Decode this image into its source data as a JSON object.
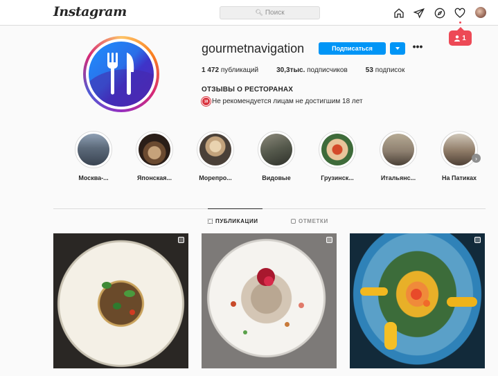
{
  "header": {
    "logo": "Instagram",
    "search_placeholder": "Поиск",
    "notification_count": "1"
  },
  "profile": {
    "username": "gourmetnavigation",
    "subscribe_label": "Подписаться",
    "stats": [
      {
        "value": "1 472",
        "label": "публикаций"
      },
      {
        "value": "30,3тыс.",
        "label": "подписчиков"
      },
      {
        "value": "53",
        "label": "подписок"
      }
    ],
    "bio_title": "ОТЗЫВЫ О РЕСТОРАНАХ",
    "bio_age_badge": "18",
    "bio_line": "Не рекомендуется лицам не достигшим 18 лет"
  },
  "highlights": [
    {
      "label": "Москва-..."
    },
    {
      "label": "Японская..."
    },
    {
      "label": "Морепро..."
    },
    {
      "label": "Видовые"
    },
    {
      "label": "Грузинск..."
    },
    {
      "label": "Итальянс..."
    },
    {
      "label": "На Патиках"
    }
  ],
  "tabs": [
    {
      "label": "ПУБЛИКАЦИИ",
      "active": true
    },
    {
      "label": "ОТМЕТКИ",
      "active": false
    }
  ],
  "colors": {
    "accent": "#0095f6",
    "notification": "#ed4956"
  }
}
